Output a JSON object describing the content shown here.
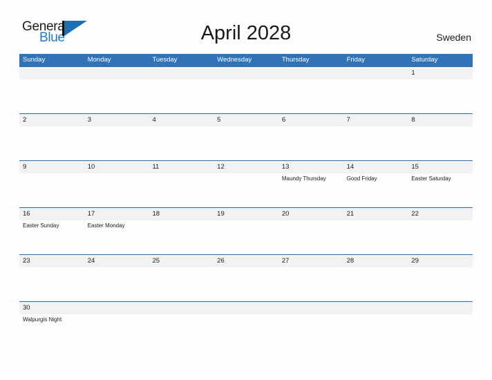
{
  "brand": {
    "name_part1": "General",
    "name_part2": "Blue",
    "logo_icon": "triangle-flag-icon",
    "color_primary": "#1b6fb5",
    "color_text": "#1c1c1c"
  },
  "header": {
    "title": "April 2028",
    "country": "Sweden"
  },
  "theme": {
    "header_blue": "#3173b8",
    "row_border_blue": "#2e6da4",
    "daynum_band_gray": "#f2f2f2",
    "page_background": "#fdfdfd"
  },
  "weekdays": [
    "Sunday",
    "Monday",
    "Tuesday",
    "Wednesday",
    "Thursday",
    "Friday",
    "Saturday"
  ],
  "weeks": [
    {
      "days": [
        {
          "num": "",
          "event": ""
        },
        {
          "num": "",
          "event": ""
        },
        {
          "num": "",
          "event": ""
        },
        {
          "num": "",
          "event": ""
        },
        {
          "num": "",
          "event": ""
        },
        {
          "num": "",
          "event": ""
        },
        {
          "num": "1",
          "event": ""
        }
      ]
    },
    {
      "days": [
        {
          "num": "2",
          "event": ""
        },
        {
          "num": "3",
          "event": ""
        },
        {
          "num": "4",
          "event": ""
        },
        {
          "num": "5",
          "event": ""
        },
        {
          "num": "6",
          "event": ""
        },
        {
          "num": "7",
          "event": ""
        },
        {
          "num": "8",
          "event": ""
        }
      ]
    },
    {
      "days": [
        {
          "num": "9",
          "event": ""
        },
        {
          "num": "10",
          "event": ""
        },
        {
          "num": "11",
          "event": ""
        },
        {
          "num": "12",
          "event": ""
        },
        {
          "num": "13",
          "event": "Maundy Thursday"
        },
        {
          "num": "14",
          "event": "Good Friday"
        },
        {
          "num": "15",
          "event": "Easter Saturday"
        }
      ]
    },
    {
      "days": [
        {
          "num": "16",
          "event": "Easter Sunday"
        },
        {
          "num": "17",
          "event": "Easter Monday"
        },
        {
          "num": "18",
          "event": ""
        },
        {
          "num": "19",
          "event": ""
        },
        {
          "num": "20",
          "event": ""
        },
        {
          "num": "21",
          "event": ""
        },
        {
          "num": "22",
          "event": ""
        }
      ]
    },
    {
      "days": [
        {
          "num": "23",
          "event": ""
        },
        {
          "num": "24",
          "event": ""
        },
        {
          "num": "25",
          "event": ""
        },
        {
          "num": "26",
          "event": ""
        },
        {
          "num": "27",
          "event": ""
        },
        {
          "num": "28",
          "event": ""
        },
        {
          "num": "29",
          "event": ""
        }
      ]
    },
    {
      "days": [
        {
          "num": "30",
          "event": "Walpurgis Night"
        },
        {
          "num": "",
          "event": ""
        },
        {
          "num": "",
          "event": ""
        },
        {
          "num": "",
          "event": ""
        },
        {
          "num": "",
          "event": ""
        },
        {
          "num": "",
          "event": ""
        },
        {
          "num": "",
          "event": ""
        }
      ]
    }
  ]
}
